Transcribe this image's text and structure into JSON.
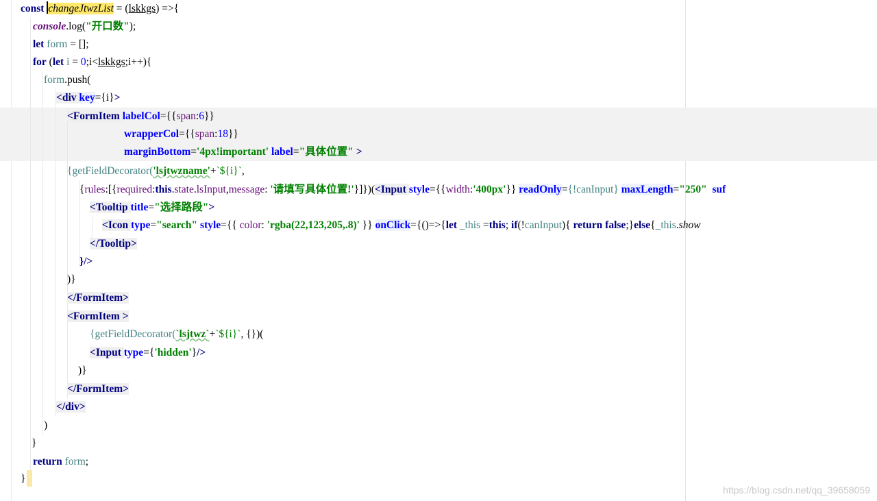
{
  "code": {
    "l1": {
      "kw": "const",
      "name": "changeJtwzList",
      "mid": " = (",
      "param": "lskkgs",
      "end": ") =>{"
    },
    "l2": {
      "obj": "console",
      "call": ".log(",
      "arg": "\"开口数\"",
      "end": ");"
    },
    "l3": {
      "kw": "let",
      "name": "form",
      "end": " = [];"
    },
    "l4": {
      "kw1": "for",
      "p1": " (",
      "kw2": "let",
      "name": "i",
      "eq": " = ",
      "zero": "0",
      "mid": ";i<",
      "param": "lskkgs",
      "end": ";i++){"
    },
    "l5": {
      "name": "form",
      "call": ".push("
    },
    "l6": {
      "tag": "<div ",
      "attr": "key",
      "eq": "=",
      "val": "{i}",
      "close": ">"
    },
    "l7": {
      "tag": "<FormItem ",
      "attr": "labelCol",
      "eq": "=",
      "open": "{{",
      "key": "span",
      "colon": ":",
      "num": "6",
      "close": "}}"
    },
    "l8": {
      "attr": "wrapperCol",
      "eq": "=",
      "open": "{{",
      "key": "span",
      "colon": ":",
      "num": "18",
      "close": "}}"
    },
    "l9": {
      "attr1": "marginBottom",
      "eq1": "=",
      "val1": "'4px!important'",
      "attr2": "label",
      "eq2": "=",
      "val2": "\"具体位置\"",
      "close": " >"
    },
    "l10": {
      "open": "{getFieldDecorator(",
      "str": "'lsjtwzname'",
      "plus": "+",
      "tmpl": "`${i}`",
      "end": ","
    },
    "l11": {
      "a": "{",
      "rules": "rules",
      "b": ":[{",
      "req": "required",
      "c": ":",
      "this": "this",
      "d": ".",
      "state": "state",
      "e": ".",
      "ls": "lsInput",
      "f": ",",
      "msg": "message",
      "g": ": ",
      "str": "'请填写具体位置!'",
      "h": "}]})(",
      "tag": "<Input ",
      "a1": "style",
      "eq1": "=",
      "v1o": "{{",
      "wk": "width",
      "wc": ":",
      "wv": "'400px'",
      "v1c": "}}",
      "a2": "readOnly",
      "eq2": "=",
      "v2": "{!canInput}",
      "a3": "maxLength",
      "eq3": "=",
      "v3": "\"250\"",
      "tail": "  suf"
    },
    "l12": {
      "tag": "<Tooltip ",
      "attr": "title",
      "eq": "=",
      "val": "\"选择路段\"",
      "close": ">"
    },
    "l13": {
      "tag": "<Icon ",
      "a1": "type",
      "eq1": "=",
      "v1": "\"search\"",
      "a2": "style",
      "eq2": "=",
      "v2o": "{{ ",
      "ck": "color",
      "cc": ": ",
      "cv": "'rgba(22,123,205,.8)'",
      "v2c": " }}",
      "a3": "onClick",
      "eq3": "=",
      "body1": "{()=>{",
      "kwlet": "let",
      "thisv": " _this",
      "eqs": " =",
      "kwthis": "this",
      "semi": "; ",
      "kwif": "if",
      "cond1": "(!",
      "can": "canInput",
      "cond2": "){ ",
      "kwret": "return",
      "sp": " ",
      "kwfalse": "false",
      "semi2": ";}",
      "kwelse": "else",
      "br": "{",
      "thisv2": "_this",
      "dot": ".",
      "show": "show"
    },
    "l14": {
      "tag": "</Tooltip>"
    },
    "l15": {
      "text": "}/>"
    },
    "l16": {
      "text": ")}"
    },
    "l17": {
      "tag": "</FormItem>"
    },
    "l18": {
      "tag": "<FormItem >"
    },
    "l19": {
      "open": "{getFieldDecorator(",
      "str": "`lsjtwz`",
      "plus": "+",
      "tmpl": "`${i}`",
      "end": ", {})("
    },
    "l20": {
      "tag": "<Input ",
      "attr": "type",
      "eq": "=",
      "vo": "{",
      "val": "'hidden'",
      "vc": "}",
      "close": "/>"
    },
    "l21": {
      "text": ")}"
    },
    "l22": {
      "tag": "</FormItem>"
    },
    "l23": {
      "tag": "</div>"
    },
    "l24": {
      "text": ")"
    },
    "l25": {
      "text": "}"
    },
    "l26": {
      "kw": "return",
      "name": "form",
      "end": ";"
    },
    "l27": {
      "text": "}"
    }
  },
  "watermark": "https://blog.csdn.net/qq_39658059"
}
